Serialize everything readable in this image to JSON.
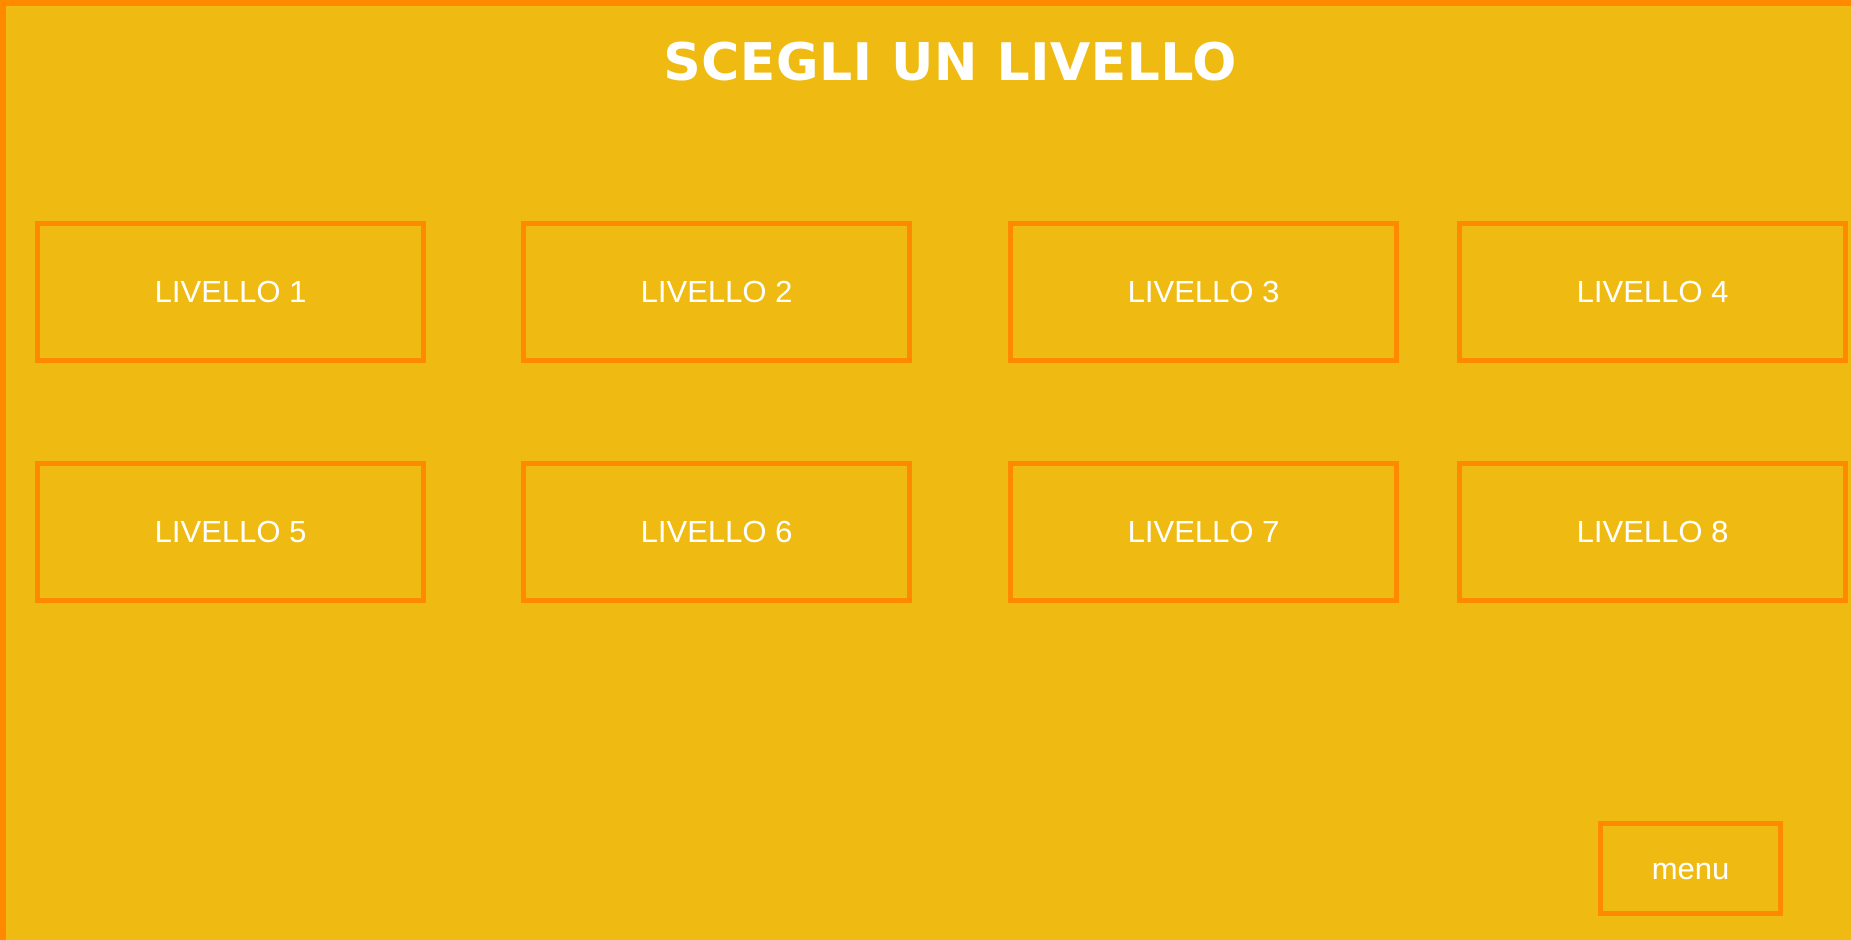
{
  "screen": {
    "title": "SCEGLI UN LIVELLO"
  },
  "levels": [
    {
      "label": "LIVELLO 1"
    },
    {
      "label": "LIVELLO 2"
    },
    {
      "label": "LIVELLO 3"
    },
    {
      "label": "LIVELLO 4"
    },
    {
      "label": "LIVELLO 5"
    },
    {
      "label": "LIVELLO 6"
    },
    {
      "label": "LIVELLO 7"
    },
    {
      "label": "LIVELLO 8"
    }
  ],
  "footer": {
    "menu_label": "menu"
  },
  "colors": {
    "background": "#efba12",
    "accent": "#ff8a00",
    "text": "#ffffff"
  }
}
